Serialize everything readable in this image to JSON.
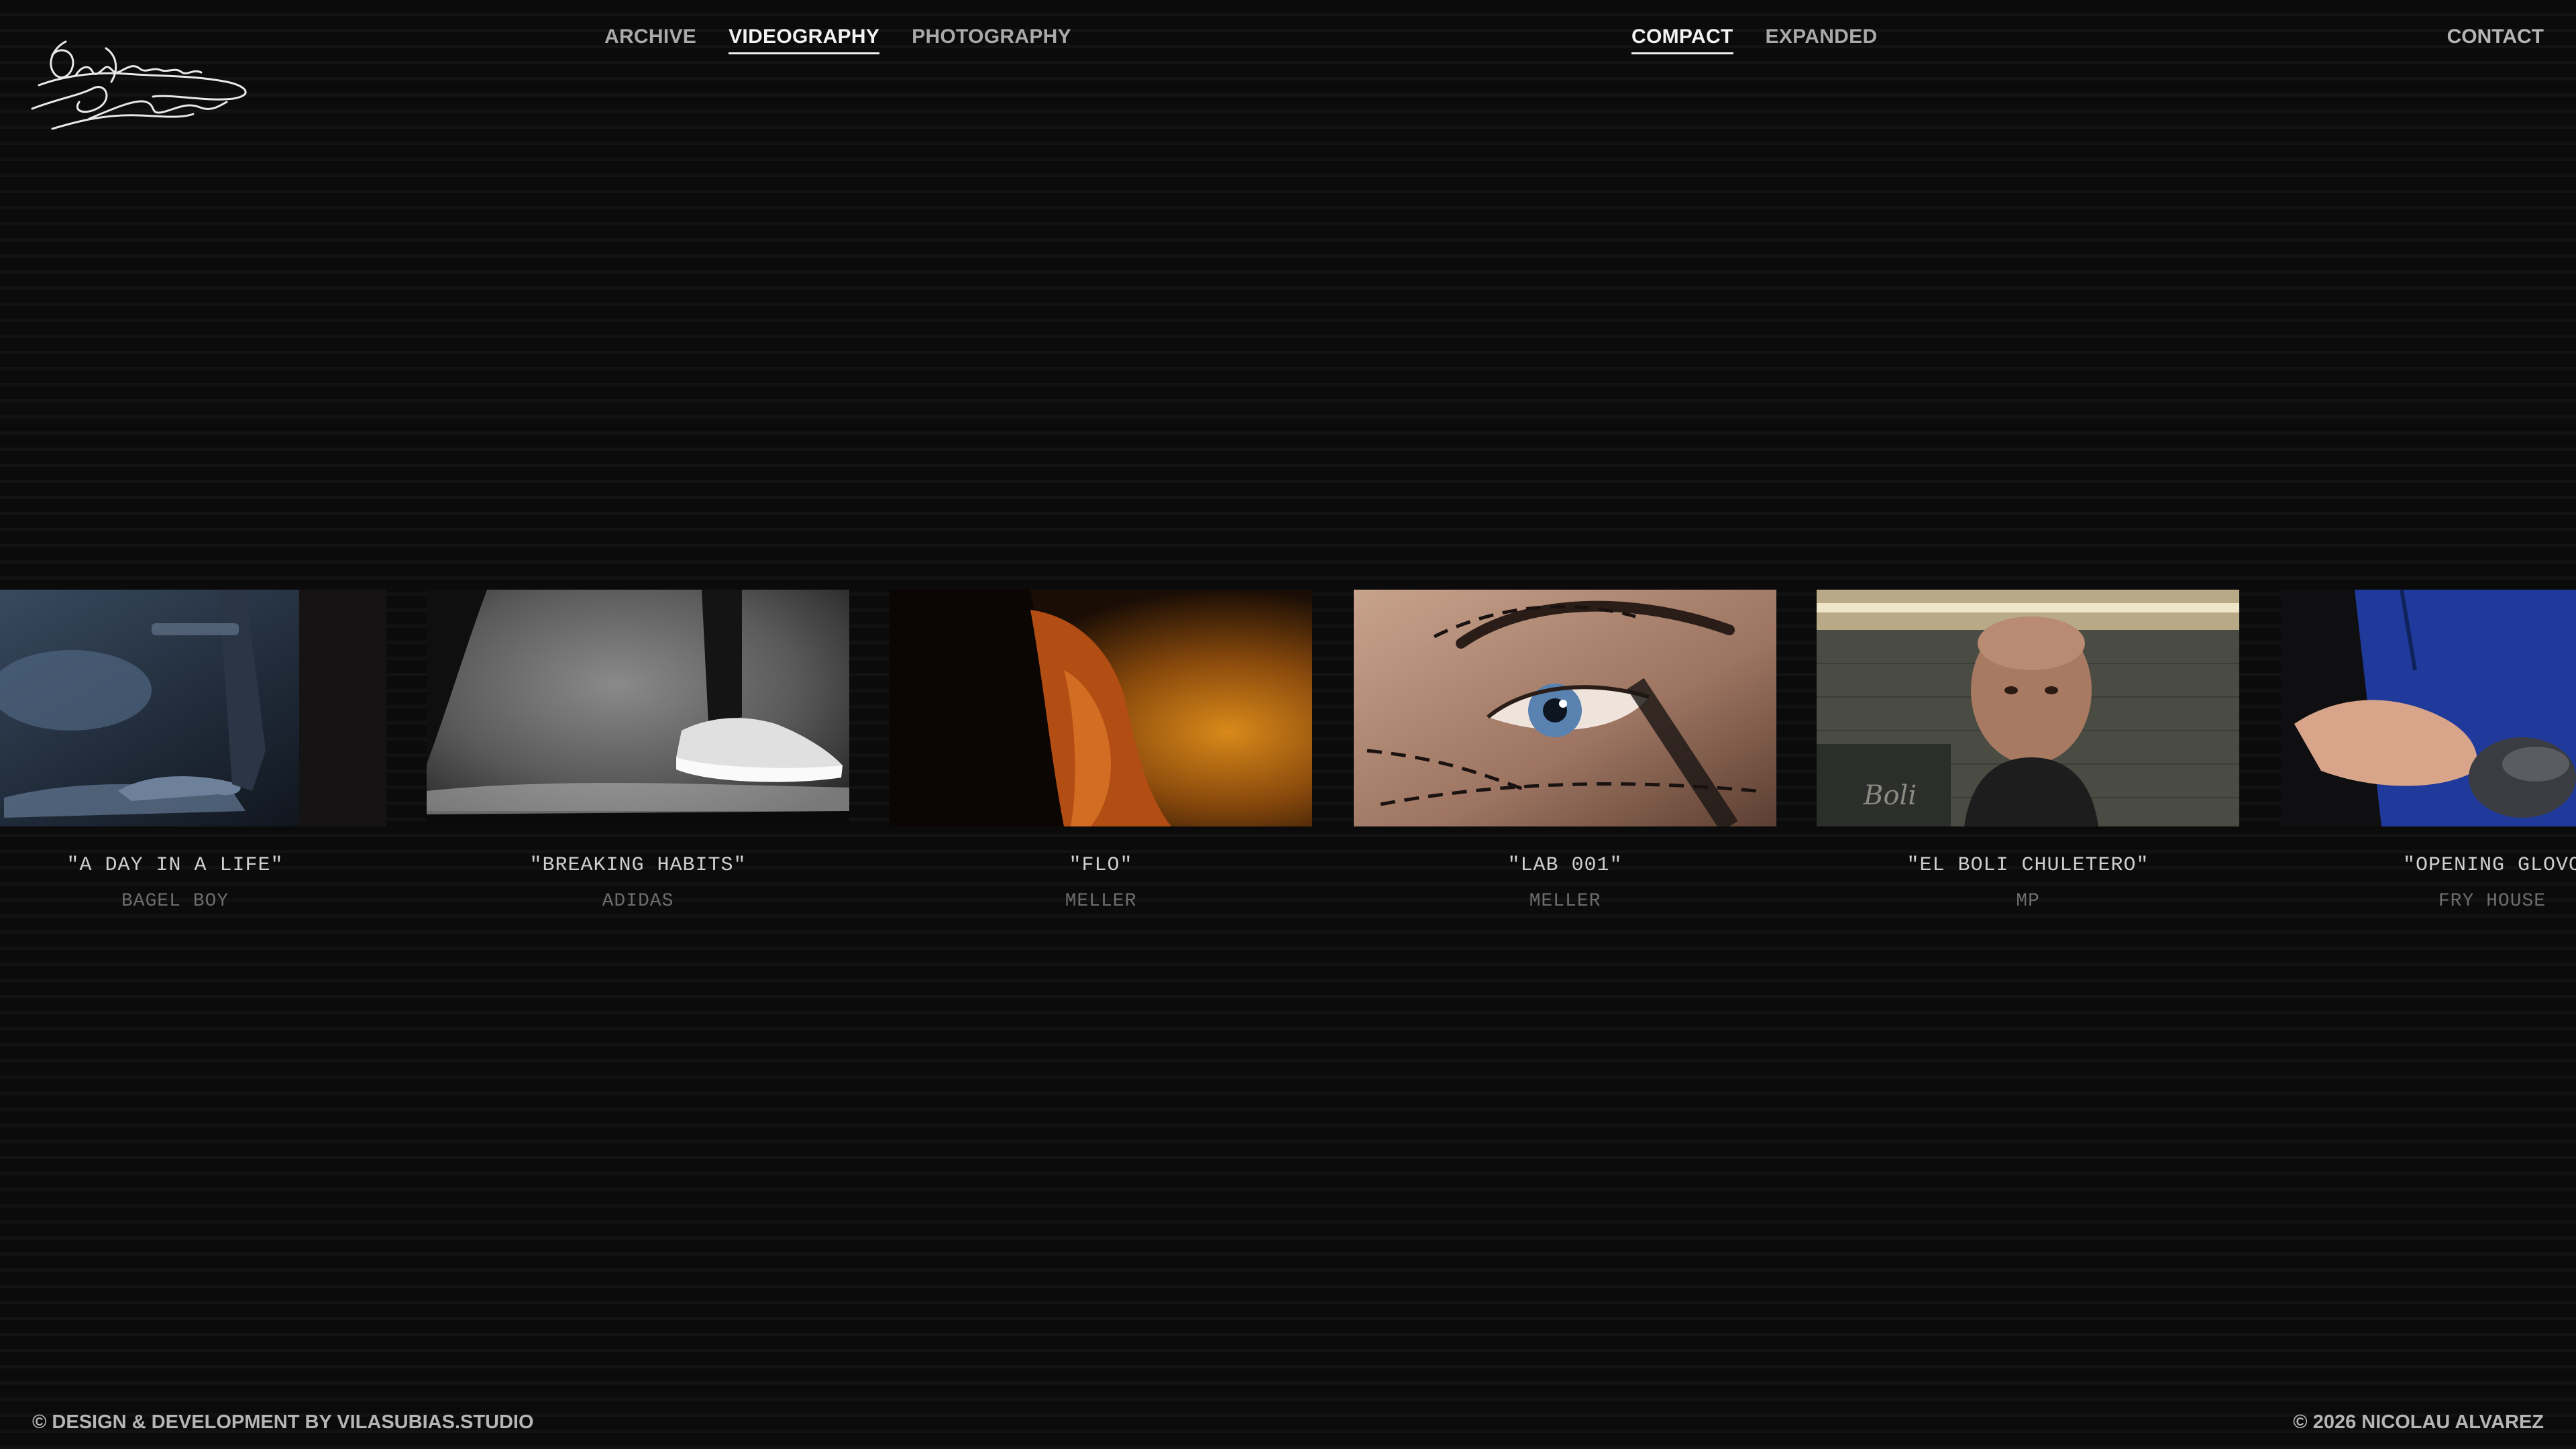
{
  "header": {
    "logo_icon": "signature-logo",
    "nav_main": [
      {
        "label": "ARCHIVE",
        "active": false
      },
      {
        "label": "VIDEOGRAPHY",
        "active": true
      },
      {
        "label": "PHOTOGRAPHY",
        "active": false
      }
    ],
    "nav_view": [
      {
        "label": "COMPACT",
        "active": true
      },
      {
        "label": "EXPANDED",
        "active": false
      }
    ],
    "contact_label": "CONTACT"
  },
  "projects": [
    {
      "title": "\"A DAY IN A LIFE\"",
      "client": "BAGEL BOY",
      "scene": "blue-studio-hand"
    },
    {
      "title": "\"BREAKING HABITS\"",
      "client": "ADIDAS",
      "scene": "monochrome-sneaker"
    },
    {
      "title": "\"FLO\"",
      "client": "MELLER",
      "scene": "orange-smoke-silhouette"
    },
    {
      "title": "\"LAB 001\"",
      "client": "MELLER",
      "scene": "eye-closeup"
    },
    {
      "title": "\"EL BOLI CHULETERO\"",
      "client": "MP",
      "scene": "man-portrait"
    },
    {
      "title": "\"OPENING GLOVO",
      "client": "FRY HOUSE",
      "scene": "hands-blue-apron"
    }
  ],
  "colors": {
    "background": "#070707",
    "text_active": "#f2f2f2",
    "text_nav": "#a9a9a9",
    "caption_title": "#cfcfcf",
    "caption_client": "#6d6d6d"
  },
  "footer": {
    "left": "© DESIGN & DEVELOPMENT BY VILASUBIAS.STUDIO",
    "right": "© 2026 NICOLAU ALVAREZ"
  }
}
